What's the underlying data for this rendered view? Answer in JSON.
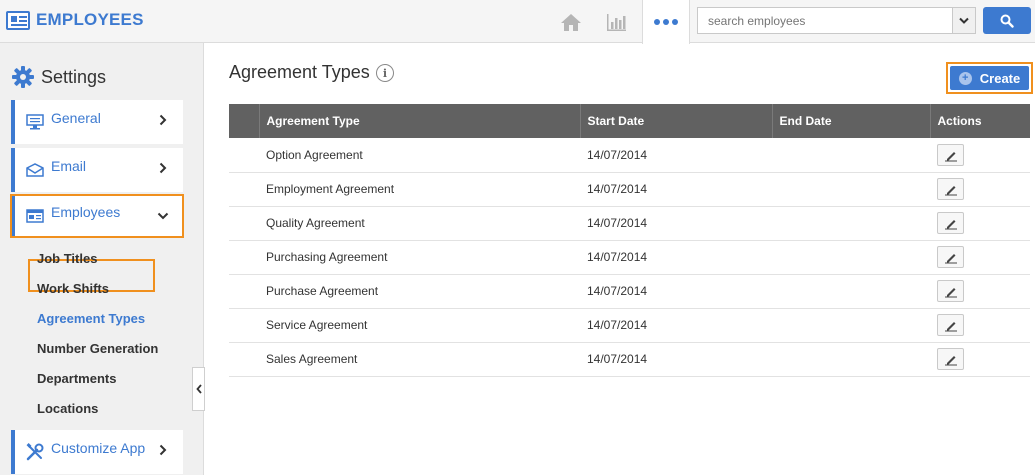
{
  "app": {
    "title": "EMPLOYEES"
  },
  "search": {
    "placeholder": "search employees"
  },
  "sidebar": {
    "heading": "Settings",
    "items": [
      {
        "label": "General",
        "icon": "monitor-icon"
      },
      {
        "label": "Email",
        "icon": "envelope-icon"
      },
      {
        "label": "Employees",
        "icon": "id-card-icon",
        "expanded": true
      },
      {
        "label": "Customize App",
        "icon": "tools-icon"
      }
    ],
    "sub_items": [
      {
        "label": "Job Titles"
      },
      {
        "label": "Work Shifts"
      },
      {
        "label": "Agreement Types",
        "active": true
      },
      {
        "label": "Number Generation"
      },
      {
        "label": "Departments"
      },
      {
        "label": "Locations"
      }
    ]
  },
  "main": {
    "title": "Agreement Types",
    "create_label": "Create",
    "table": {
      "columns": [
        "",
        "Agreement Type",
        "Start Date",
        "End Date",
        "Actions"
      ],
      "rows": [
        {
          "type": "Option Agreement",
          "start": "14/07/2014",
          "end": ""
        },
        {
          "type": "Employment Agreement",
          "start": "14/07/2014",
          "end": ""
        },
        {
          "type": "Quality Agreement",
          "start": "14/07/2014",
          "end": ""
        },
        {
          "type": "Purchasing Agreement",
          "start": "14/07/2014",
          "end": ""
        },
        {
          "type": "Purchase Agreement",
          "start": "14/07/2014",
          "end": ""
        },
        {
          "type": "Service Agreement",
          "start": "14/07/2014",
          "end": ""
        },
        {
          "type": "Sales Agreement",
          "start": "14/07/2014",
          "end": ""
        }
      ]
    }
  },
  "colors": {
    "accent": "#3d7ad0",
    "highlight": "#f0901e",
    "header_bg": "#616161"
  }
}
